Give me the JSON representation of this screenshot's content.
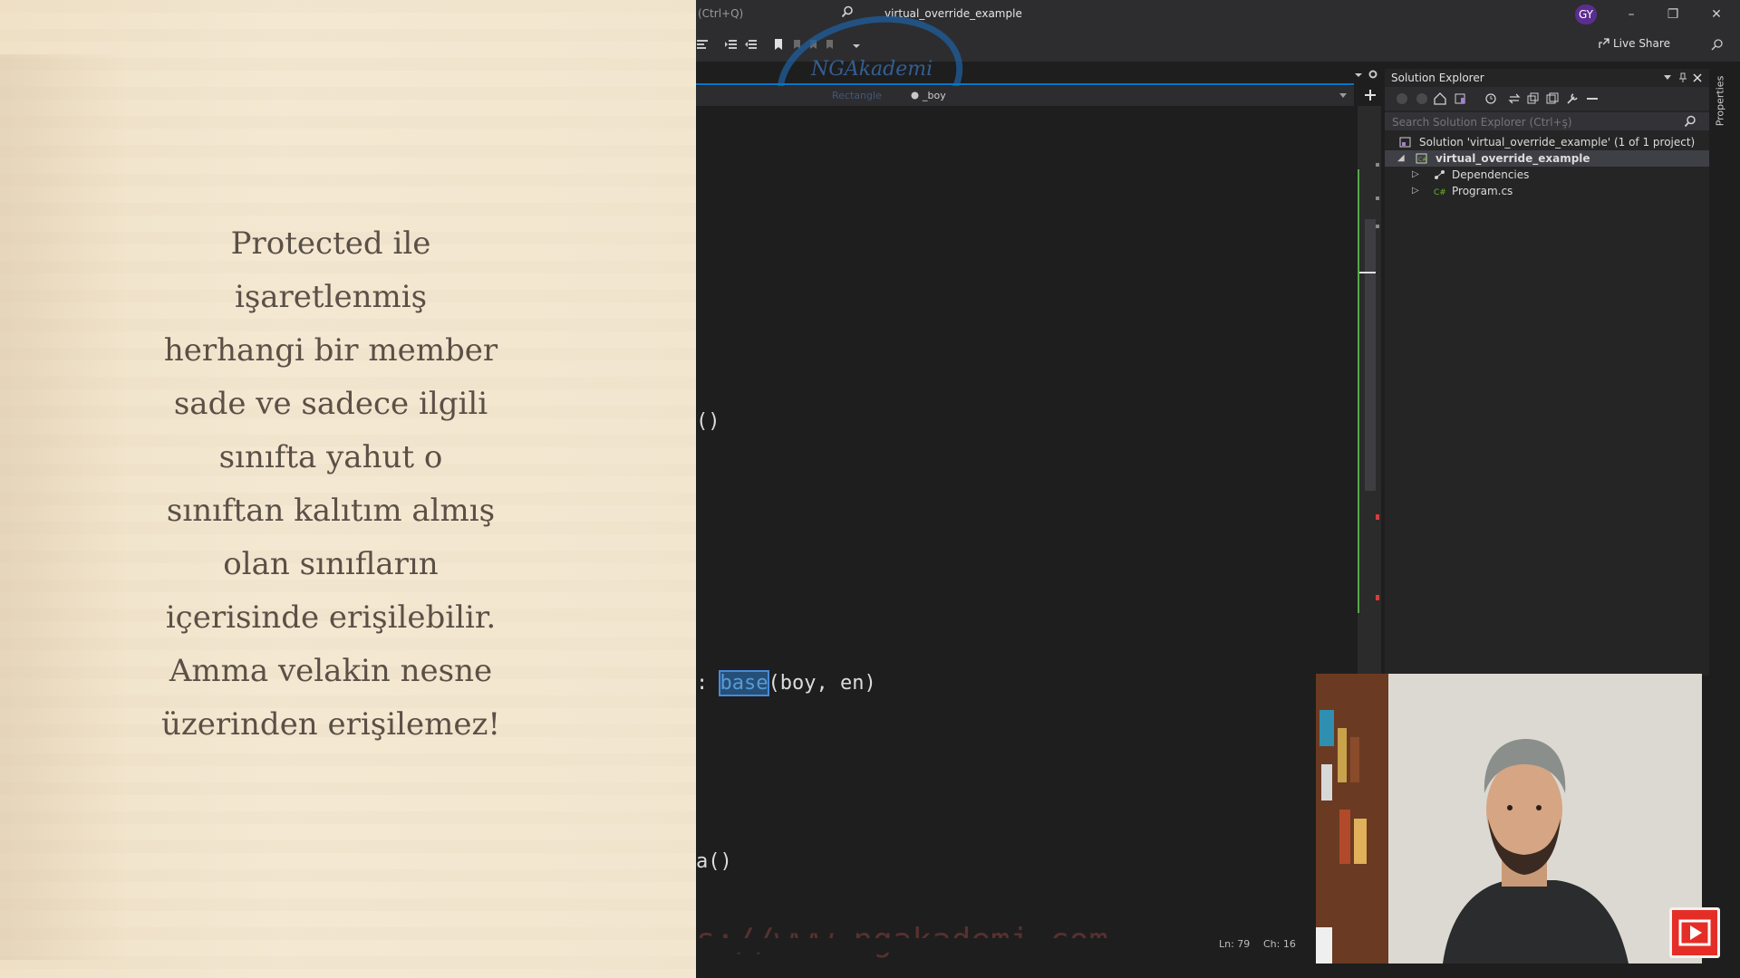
{
  "overlay": {
    "lines": [
      "Protected ile",
      "işaretlenmiş",
      "herhangi bir member",
      "sade ve sadece ilgili",
      "sınıfta yahut o",
      "sınıftan kalıtım almış",
      "olan sınıfların",
      "içerisinde erişilebilir.",
      "Amma velakin nesne",
      "üzerinden erişilemez!"
    ]
  },
  "titlebar": {
    "search_hint": "(Ctrl+Q)",
    "solution_name": "virtual_override_example",
    "avatar_initials": "GY",
    "minimize": "–",
    "restore": "❐",
    "close": "✕"
  },
  "toolbar": {
    "live_share": "Live Share"
  },
  "editor": {
    "nav_member": "_boy",
    "nav_project": "Rectangle",
    "code_lines": {
      "l1": "()",
      "l2_prefix": ": ",
      "l2_keyword": "base",
      "l2_suffix": "(boy, en)",
      "l3": "a()"
    }
  },
  "watermark": {
    "logo_text": "NGAkademi",
    "site_url": "s://www.ngakademi.com"
  },
  "statusbar": {
    "line": "Ln: 79",
    "char": "Ch: 16"
  },
  "solution_explorer": {
    "title": "Solution Explorer",
    "search_placeholder": "Search Solution Explorer (Ctrl+ş)",
    "tree": {
      "solution": "Solution 'virtual_override_example' (1 of 1 project)",
      "project": "virtual_override_example",
      "dependencies": "Dependencies",
      "program": "Program.cs"
    }
  },
  "properties_tab": "Properties",
  "colors": {
    "accent": "#007acc",
    "keyword": "#569cd6",
    "overlay_bg": "#f3e6cf",
    "overlay_text": "#5a5046",
    "youtube": "#e52d27"
  }
}
